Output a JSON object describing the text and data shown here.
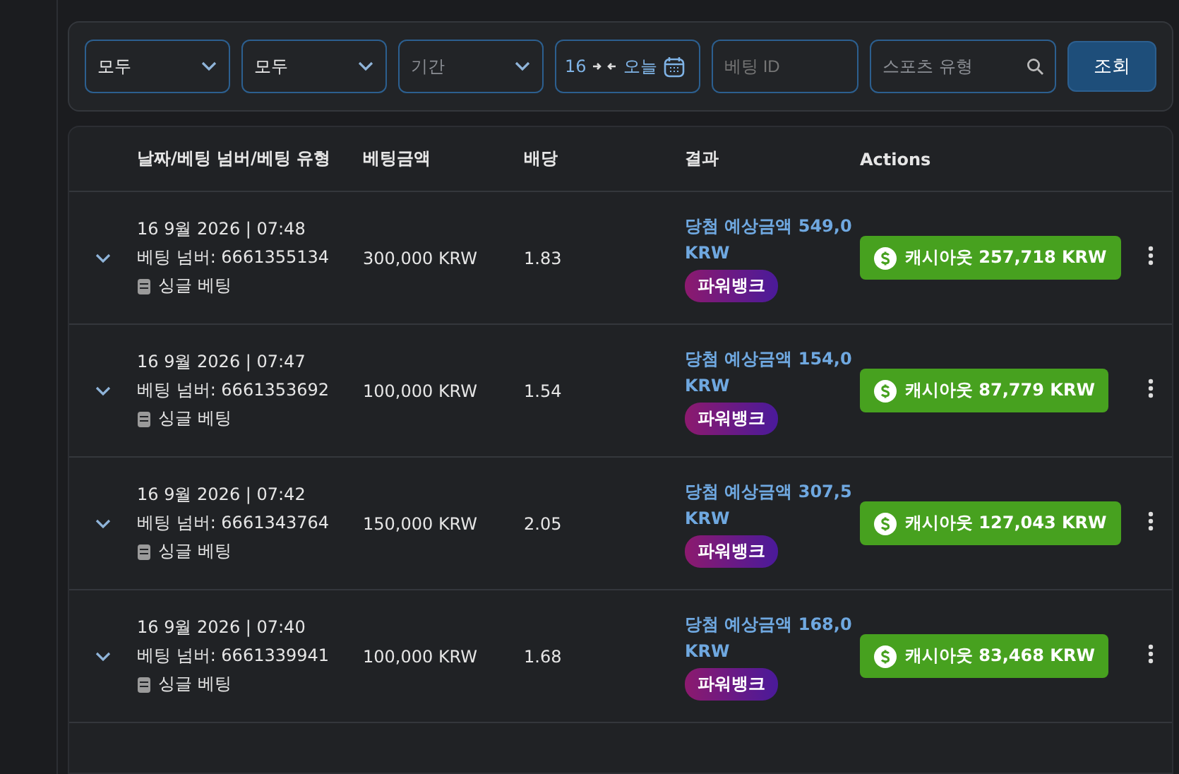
{
  "filters": {
    "selects": [
      {
        "value": "모두",
        "kind": "value"
      },
      {
        "value": "모두",
        "kind": "value"
      },
      {
        "placeholder": "기간",
        "kind": "placeholder"
      }
    ],
    "date_range": {
      "start": "16",
      "end": "오늘"
    },
    "bet_id": {
      "placeholder": "베팅 ID"
    },
    "sport": {
      "placeholder": "스포츠 유형"
    },
    "submit": "조회"
  },
  "table": {
    "columns": [
      "날짜/베팅 넘버/베팅 유형",
      "베팅금액",
      "배당",
      "결과",
      "Actions"
    ],
    "rows": [
      {
        "date": "16 9월 2026 | 07:48",
        "bet_number": "베팅 넘버: 6661355134",
        "bet_type": "싱글 베팅",
        "amount": "300,000 KRW",
        "odds": "1.83",
        "result": "당첨 예상금액 549,0",
        "result_currency": "KRW",
        "tag": "파워뱅크",
        "cashout": "캐시아웃 257,718 KRW"
      },
      {
        "date": "16 9월 2026 | 07:47",
        "bet_number": "베팅 넘버: 6661353692",
        "bet_type": "싱글 베팅",
        "amount": "100,000 KRW",
        "odds": "1.54",
        "result": "당첨 예상금액 154,0",
        "result_currency": "KRW",
        "tag": "파워뱅크",
        "cashout": "캐시아웃 87,779 KRW"
      },
      {
        "date": "16 9월 2026 | 07:42",
        "bet_number": "베팅 넘버: 6661343764",
        "bet_type": "싱글 베팅",
        "amount": "150,000 KRW",
        "odds": "2.05",
        "result": "당첨 예상금액 307,5",
        "result_currency": "KRW",
        "tag": "파워뱅크",
        "cashout": "캐시아웃 127,043 KRW"
      },
      {
        "date": "16 9월 2026 | 07:40",
        "bet_number": "베팅 넘버: 6661339941",
        "bet_type": "싱글 베팅",
        "amount": "100,000 KRW",
        "odds": "1.68",
        "result": "당첨 예상금액 168,0",
        "result_currency": "KRW",
        "tag": "파워뱅크",
        "cashout": "캐시아웃 83,468 KRW"
      }
    ]
  }
}
